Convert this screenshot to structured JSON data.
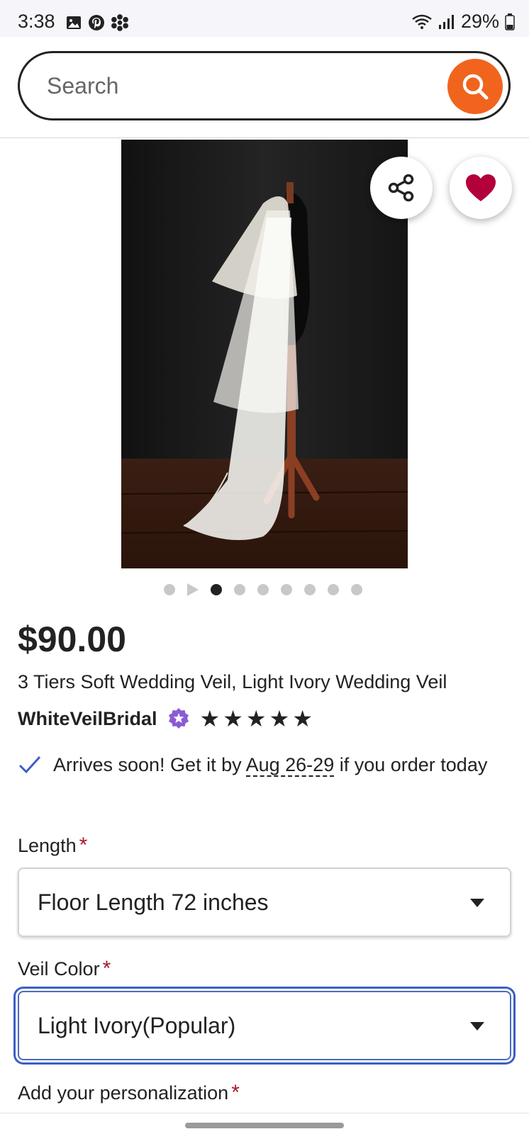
{
  "status_bar": {
    "time": "3:38",
    "left_icons": [
      "gallery-icon",
      "pinterest-icon",
      "app-icon"
    ],
    "battery": "29%"
  },
  "search": {
    "placeholder": "Search",
    "button_icon": "search-icon",
    "accent_color": "#f1641e"
  },
  "product": {
    "image_icon_share": "share-icon",
    "image_icon_favorite": "heart-icon",
    "favorite_color": "#b3003a",
    "carousel": {
      "total_dots": 8,
      "has_video": true,
      "active_index": 2
    },
    "price": "$90.00",
    "title": "3 Tiers Soft Wedding Veil, Light Ivory Wedding Veil",
    "seller": "WhiteVeilBridal",
    "star_seller_badge": "star-seller-icon",
    "rating_stars": 5
  },
  "shipping": {
    "text_before": "Arrives soon! Get it by ",
    "date": "Aug 26-29",
    "text_after": " if you order today"
  },
  "options": {
    "length": {
      "label": "Length",
      "required_mark": "*",
      "value": "Floor Length 72 inches"
    },
    "color": {
      "label": "Veil Color",
      "required_mark": "*",
      "value": "Light Ivory(Popular)"
    },
    "personalization": {
      "label": "Add your personalization",
      "required_mark": "*"
    }
  }
}
